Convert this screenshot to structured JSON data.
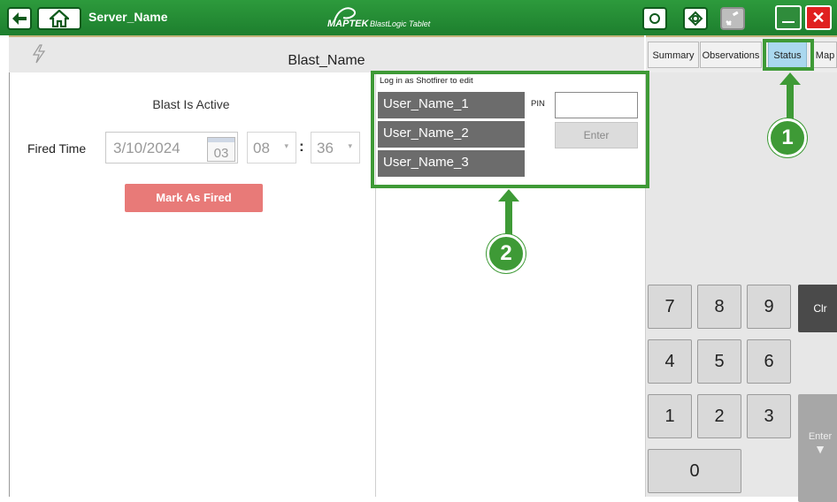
{
  "titlebar": {
    "server_name": "Server_Name",
    "logo_brand": "MAPTEK",
    "logo_product": "BlastLogic Tablet",
    "icons": [
      "back-arrow-icon",
      "home-icon",
      "refresh-icon",
      "sync-icon",
      "disconnected-icon"
    ],
    "close_glyph": "✕"
  },
  "header": {
    "blast_name": "Blast_Name"
  },
  "status_panel": {
    "blast_status": "Blast Is Active",
    "fired_time_label": "Fired Time",
    "date_value": "3/10/2024",
    "calendar_day": "03",
    "hour_value": "08",
    "minute_value": "36",
    "time_separator": ":",
    "mark_fired_label": "Mark As Fired"
  },
  "login": {
    "hint": "Log in as Shotfirer to edit",
    "users": [
      "User_Name_1",
      "User_Name_2",
      "User_Name_3"
    ],
    "pin_label": "PIN",
    "pin_value": "",
    "enter_label": "Enter"
  },
  "tabs": [
    {
      "label": "Summary",
      "active": false
    },
    {
      "label": "Observations",
      "active": false
    },
    {
      "label": "Status",
      "active": true
    },
    {
      "label": "Map",
      "active": false
    }
  ],
  "keypad": {
    "keys": [
      "7",
      "8",
      "9",
      "4",
      "5",
      "6",
      "1",
      "2",
      "3",
      "0"
    ],
    "clear_label": "Clr",
    "enter_label": "Enter",
    "enter_glyph": "▼"
  },
  "callouts": {
    "one": "1",
    "two": "2"
  },
  "colors": {
    "titlebar_green": "#1d7f2e",
    "callout_green": "#3e9a36",
    "mark_fired": "#e87a78",
    "active_tab": "#aad8ef",
    "close_red": "#e02020"
  }
}
